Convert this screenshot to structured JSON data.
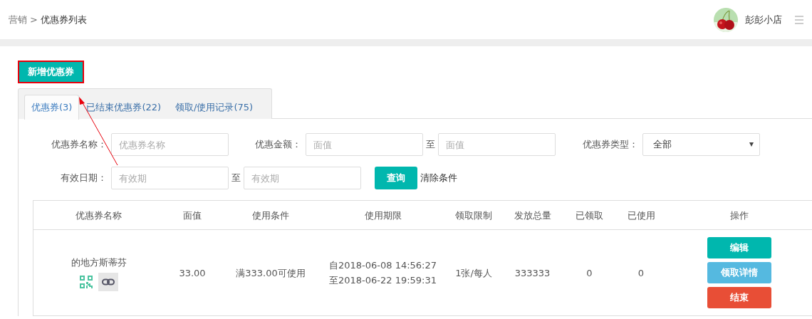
{
  "breadcrumb": {
    "parent": "营销",
    "separator": ">",
    "current": "优惠券列表"
  },
  "user": {
    "name": "彭彭小店"
  },
  "add_button": {
    "label": "新增优惠券",
    "highlighted": true
  },
  "tabs": [
    {
      "label": "优惠券(3)",
      "selected": true
    },
    {
      "label": "已结束优惠券(22)",
      "selected": false
    },
    {
      "label": "领取/使用记录(75)",
      "selected": false
    }
  ],
  "filters": {
    "name": {
      "label": "优惠券名称：",
      "placeholder": "优惠券名称"
    },
    "amount": {
      "label": "优惠金额：",
      "from_placeholder": "面值",
      "separator": "至",
      "to_placeholder": "面值"
    },
    "type": {
      "label": "优惠券类型：",
      "value": "全部"
    },
    "date": {
      "label": "有效日期：",
      "from_placeholder": "有效期",
      "separator": "至",
      "to_placeholder": "有效期"
    },
    "search_button": "查询",
    "clear_link": "清除条件"
  },
  "table": {
    "columns": [
      "优惠券名称",
      "面值",
      "使用条件",
      "使用期限",
      "领取限制",
      "发放总量",
      "已领取",
      "已使用",
      "操作"
    ],
    "rows": [
      {
        "name": "的地方斯蒂芬",
        "value": "33.00",
        "condition": "满333.00可使用",
        "period": [
          "自2018-06-08 14:56:27",
          "至2018-06-22 19:59:31"
        ],
        "limit": "1张/每人",
        "total": "333333",
        "received": "0",
        "used": "0",
        "actions": [
          {
            "label": "编辑",
            "kind": "primary"
          },
          {
            "label": "领取详情",
            "kind": "info"
          },
          {
            "label": "结束",
            "kind": "danger"
          }
        ]
      }
    ]
  }
}
